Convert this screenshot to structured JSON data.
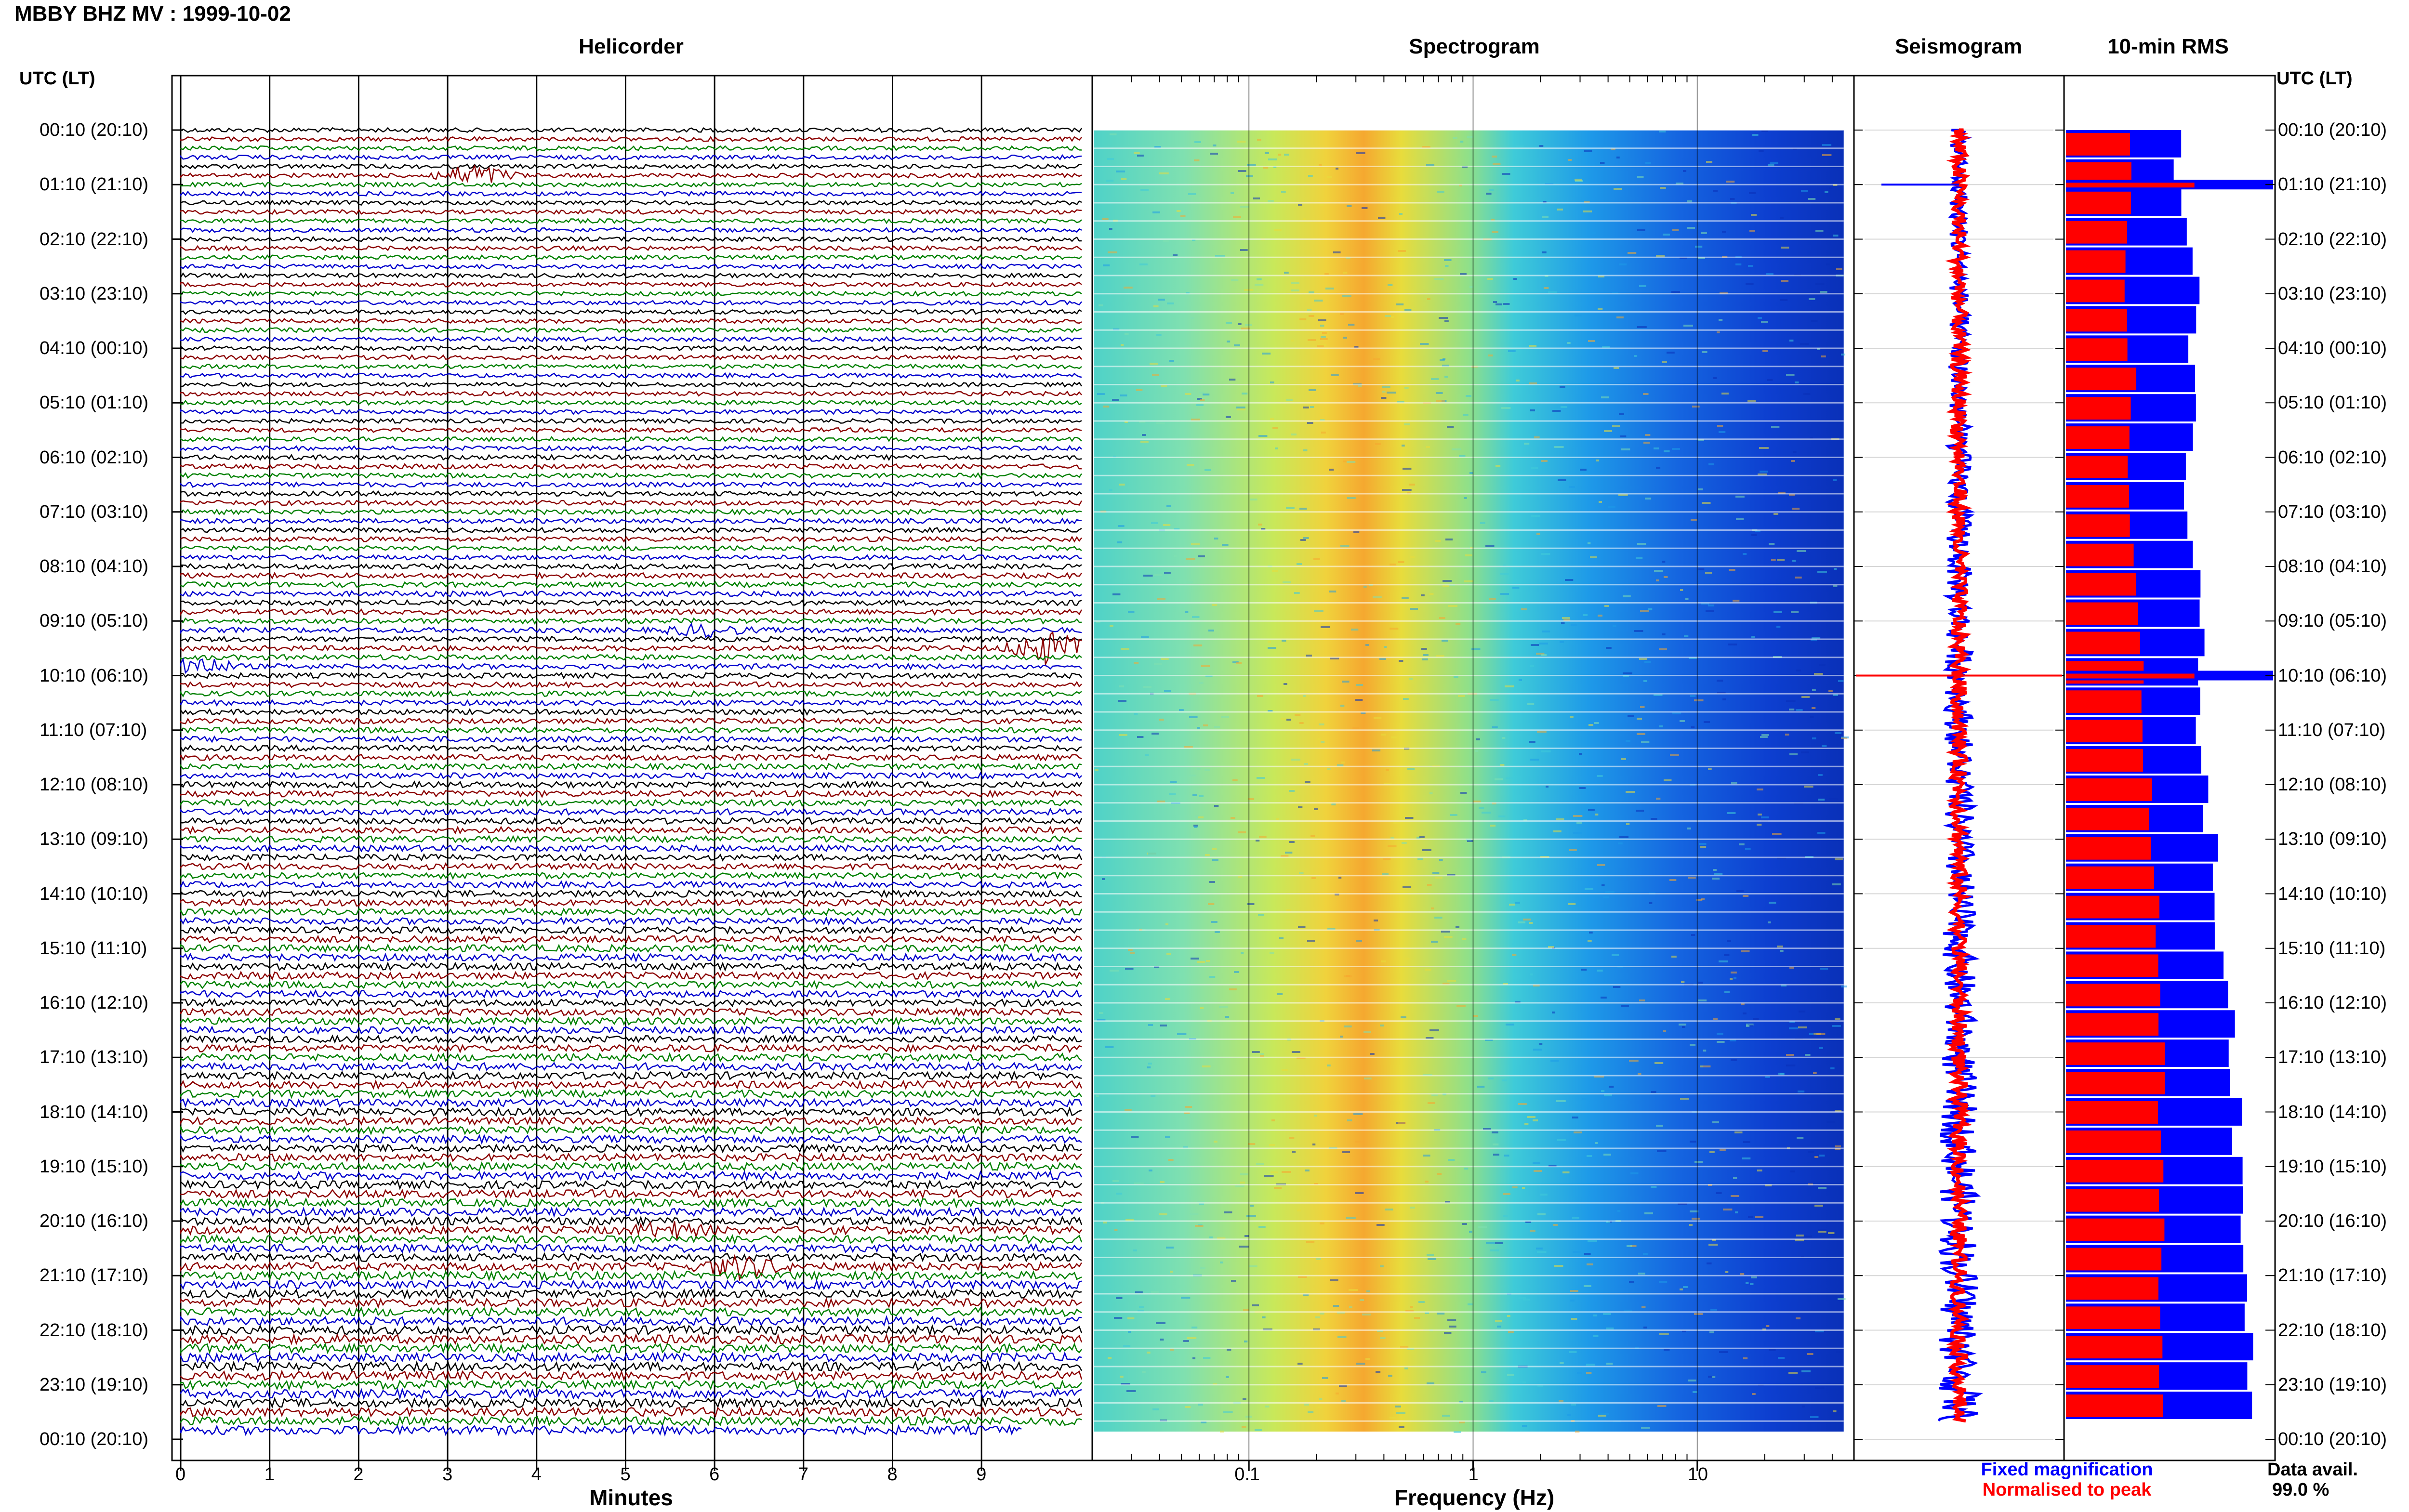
{
  "station_title": "MBBY BHZ MV : 1999-10-02",
  "panels": {
    "helicorder": "Helicorder",
    "spectrogram": "Spectrogram",
    "seismogram": "Seismogram",
    "rms": "10-min RMS"
  },
  "time_axis_header": "UTC (LT)",
  "colors": {
    "trace_cycle": [
      "#000000",
      "#8b0000",
      "#008000",
      "#0000cd"
    ],
    "fixed": "#0000ff",
    "normalised": "#ff0000"
  },
  "chart_data": [
    {
      "type": "line",
      "name": "helicorder",
      "title": "Helicorder",
      "xlabel": "Minutes",
      "xlim": [
        0,
        10
      ],
      "x_ticks": [
        "0",
        "1",
        "2",
        "3",
        "4",
        "5",
        "6",
        "7",
        "8",
        "9"
      ],
      "row_labels": [
        "00:10 (20:10)",
        "01:10 (21:10)",
        "02:10 (22:10)",
        "03:10 (23:10)",
        "04:10 (00:10)",
        "05:10 (01:10)",
        "06:10 (02:10)",
        "07:10 (03:10)",
        "08:10 (04:10)",
        "09:10 (05:10)",
        "10:10 (06:10)",
        "11:10 (07:10)",
        "12:10 (08:10)",
        "13:10 (09:10)",
        "14:10 (10:10)",
        "15:10 (11:10)",
        "16:10 (12:10)",
        "17:10 (13:10)",
        "18:10 (14:10)",
        "19:10 (15:10)",
        "20:10 (16:10)",
        "21:10 (17:10)",
        "22:10 (18:10)",
        "23:10 (19:10)",
        "00:10 (20:10)"
      ],
      "rows_count": 144,
      "relative_amplitude": [
        0.5,
        0.5,
        0.5,
        0.5,
        0.5,
        0.5,
        0.55,
        0.55,
        0.6,
        0.6,
        0.6,
        0.65,
        0.7,
        0.7,
        0.75,
        0.8,
        0.8,
        0.85,
        0.85,
        0.9,
        0.9,
        0.95,
        1.0,
        1.0
      ],
      "events": [
        {
          "row": 5,
          "minute": 3.3,
          "amplitude": 4.5
        },
        {
          "row": 59,
          "minute": 0.1,
          "amplitude": 4
        },
        {
          "row": 57,
          "minute": 9.75,
          "amplitude": 6
        },
        {
          "row": 55,
          "minute": 5.9,
          "amplitude": 2
        },
        {
          "row": 125,
          "minute": 6.3,
          "amplitude": 2.5
        },
        {
          "row": 121,
          "minute": 5.5,
          "amplitude": 1.6
        }
      ]
    },
    {
      "type": "heatmap",
      "name": "spectrogram",
      "title": "Spectrogram",
      "xlabel": "Frequency (Hz)",
      "xscale": "log",
      "xlim": [
        0.02,
        50
      ],
      "x_ticks": [
        "0.1",
        "1",
        "10"
      ],
      "peak_band_hz": [
        0.25,
        0.5
      ],
      "data_end_hz": 45
    },
    {
      "type": "line",
      "name": "seismogram",
      "title": "Seismogram",
      "spikes": [
        {
          "row": 6,
          "direction": "left",
          "color": "blue"
        },
        {
          "row": 60,
          "direction": "both",
          "color": "red"
        }
      ]
    },
    {
      "type": "bar",
      "name": "rms",
      "title": "10-min RMS",
      "orientation": "horizontal",
      "series": [
        {
          "name": "Fixed magnification",
          "color": "#0000ff",
          "values": [
            0.55,
            0.55,
            0.58,
            0.58,
            0.6,
            0.62,
            0.6,
            0.6,
            0.62,
            0.62,
            0.6,
            0.6,
            0.58,
            0.6,
            0.62,
            0.62,
            0.64,
            0.64,
            0.62,
            0.62,
            0.64,
            0.64,
            0.66,
            0.66,
            0.72,
            0.72,
            0.74,
            0.74,
            0.78,
            0.78,
            0.8,
            0.8,
            0.8,
            0.82,
            0.82,
            0.84,
            0.86,
            0.86,
            0.84,
            0.86,
            0.88,
            0.88,
            0.9,
            0.9
          ]
        },
        {
          "name": "Normalised to peak",
          "color": "#ff0000",
          "values": [
            0.3,
            0.3,
            0.3,
            0.3,
            0.3,
            0.3,
            0.3,
            0.3,
            0.32,
            0.32,
            0.3,
            0.3,
            0.32,
            0.32,
            0.34,
            0.34,
            0.36,
            0.36,
            0.36,
            0.36,
            0.38,
            0.38,
            0.4,
            0.4,
            0.42,
            0.42,
            0.44,
            0.44,
            0.44,
            0.44,
            0.46,
            0.46,
            0.46,
            0.46,
            0.46,
            0.46,
            0.46,
            0.46,
            0.46,
            0.46,
            0.46,
            0.46,
            0.46,
            0.46
          ]
        }
      ],
      "spikes": [
        {
          "row": 6,
          "series": "both",
          "value": 1.0
        },
        {
          "row": 60,
          "series": "both",
          "value": 1.0
        }
      ]
    }
  ],
  "legend": {
    "fixed": "Fixed magnification",
    "normalised": "Normalised to peak"
  },
  "availability": {
    "label": "Data avail.",
    "value": "99.0 %"
  }
}
